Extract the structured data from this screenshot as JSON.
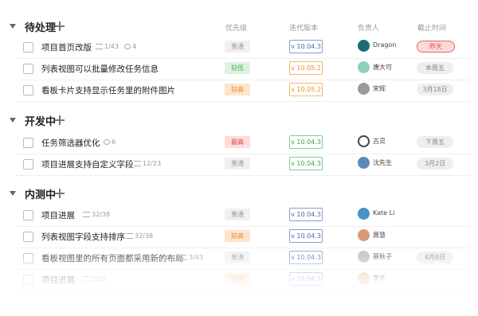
{
  "columns": {
    "priority": "优先级",
    "version": "迭代版本",
    "owner": "负责人",
    "due": "截止时间"
  },
  "groups": [
    {
      "title": "待处理",
      "rows": [
        {
          "title": "项目首页改版",
          "subtask": "1/43",
          "comments": "4",
          "priority": "普通",
          "priority_level": "normal",
          "version": "v 10.04.3",
          "version_color": "blue",
          "owner": "Dragon",
          "avatar_color": "#1e6b74",
          "due": "昨天",
          "overdue": true
        },
        {
          "title": "列表视图可以批量修改任务信息",
          "priority": "较低",
          "priority_level": "low",
          "version": "v 10.05.2",
          "version_color": "orange",
          "owner": "唐大可",
          "avatar_color": "#8fd0c0",
          "due": "本周五"
        },
        {
          "title": "看板卡片支持显示任务里的附件图片",
          "priority": "较高",
          "priority_level": "high",
          "version": "v 10.05.2",
          "version_color": "orange",
          "owner": "宋辉",
          "avatar_color": "#9a9a9a",
          "due": "3月18日"
        }
      ]
    },
    {
      "title": "开发中",
      "rows": [
        {
          "title": "任务筛选器优化",
          "comments": "6",
          "priority": "最高",
          "priority_level": "top",
          "version": "v 10.04.3",
          "version_color": "green",
          "owner": "古灵",
          "avatar_color": "#444444",
          "due": "下周五"
        },
        {
          "title": "项目进展支持自定义字段",
          "subtask": "12/23",
          "priority": "普通",
          "priority_level": "normal",
          "version": "v 10.04.3",
          "version_color": "green",
          "owner": "沈先生",
          "avatar_color": "#5b8ab8",
          "due": "3月2日"
        }
      ]
    },
    {
      "title": "内测中",
      "rows": [
        {
          "title": "项目进展",
          "subtask": "32/38",
          "priority": "普通",
          "priority_level": "normal",
          "version": "v 10.04.3",
          "version_color": "blue",
          "owner": "Kate Li",
          "avatar_color": "#4a93c8"
        },
        {
          "title": "列表视图字段支持排序",
          "subtask": "32/38",
          "priority": "较高",
          "priority_level": "high",
          "version": "v 10.04.3",
          "version_color": "blue",
          "owner": "周慧",
          "avatar_color": "#d99a7a"
        },
        {
          "title": "看板视图里的所有页面都采用新的布局",
          "subtask": "3/43",
          "priority": "普通",
          "priority_level": "normal",
          "version": "v 10.04.3",
          "version_color": "blue",
          "owner": "蔡秋子",
          "avatar_color": "#bbbbbb",
          "due": "4月8日"
        },
        {
          "title": "项目进展",
          "subtask": "3/12",
          "priority": "较高",
          "priority_level": "high",
          "version": "v 10.04.3",
          "version_color": "blue",
          "owner": "李冬",
          "avatar_color": "#e2c09a"
        }
      ]
    }
  ]
}
